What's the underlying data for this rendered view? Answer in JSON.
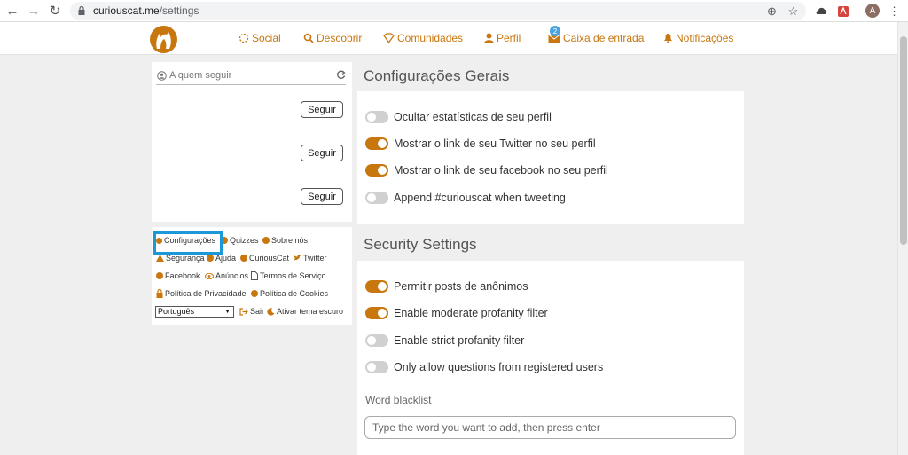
{
  "browser": {
    "url_host": "curiouscat.me",
    "url_path": "/settings",
    "avatar_letter": "A"
  },
  "nav": {
    "items": [
      {
        "label": "Social",
        "icon": "social-icon"
      },
      {
        "label": "Descobrir",
        "icon": "search-icon"
      },
      {
        "label": "Comunidades",
        "icon": "communities-icon"
      },
      {
        "label": "Perfil",
        "icon": "user-icon"
      },
      {
        "label": "Caixa de entrada",
        "icon": "inbox-icon",
        "badge": "2"
      },
      {
        "label": "Notificações",
        "icon": "bell-icon"
      }
    ]
  },
  "follow": {
    "placeholder": "A quem seguir",
    "buttons": [
      "Seguir",
      "Seguir",
      "Seguir"
    ]
  },
  "links": {
    "settings": "Configurações",
    "quizzes": "Quizzes",
    "about": "Sobre nós",
    "security": "Segurança",
    "help": "Ajuda",
    "curiouscat": "CuriousCat",
    "twitter": "Twitter",
    "facebook": "Facebook",
    "ads": "Anúncios",
    "terms": "Termos de Serviço",
    "privacy": "Política de Privacidade",
    "cookies": "Política de Cookies",
    "language": "Português",
    "logout": "Sair",
    "dark_theme": "Ativar tema escuro"
  },
  "general": {
    "title": "Configurações Gerais",
    "options": [
      {
        "label": "Ocultar estatísticas de seu perfil",
        "on": false
      },
      {
        "label": "Mostrar o link de seu Twitter no seu perfil",
        "on": true
      },
      {
        "label": "Mostrar o link de seu facebook no seu perfil",
        "on": true
      },
      {
        "label": "Append #curiouscat when tweeting",
        "on": false
      }
    ]
  },
  "security": {
    "title": "Security Settings",
    "options": [
      {
        "label": "Permitir posts de anônimos",
        "on": true
      },
      {
        "label": "Enable moderate profanity filter",
        "on": true
      },
      {
        "label": "Enable strict profanity filter",
        "on": false
      },
      {
        "label": "Only allow questions from registered users",
        "on": false
      }
    ],
    "blacklist_label": "Word blacklist",
    "blacklist_placeholder": "Type the word you want to add, then press enter"
  },
  "colors": {
    "accent": "#c8770f",
    "highlight": "#1b98d8"
  }
}
